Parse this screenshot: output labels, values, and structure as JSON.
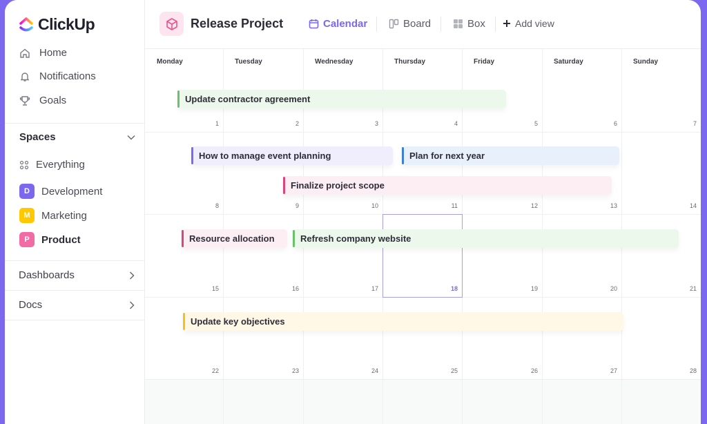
{
  "app": {
    "name": "ClickUp"
  },
  "sidebar": {
    "nav": [
      {
        "label": "Home",
        "icon": "home-icon"
      },
      {
        "label": "Notifications",
        "icon": "bell-icon"
      },
      {
        "label": "Goals",
        "icon": "trophy-icon"
      }
    ],
    "spaces_label": "Spaces",
    "everything_label": "Everything",
    "spaces": [
      {
        "initial": "D",
        "label": "Development",
        "color": "#7b68ee"
      },
      {
        "initial": "M",
        "label": "Marketing",
        "color": "#ffc800"
      },
      {
        "initial": "P",
        "label": "Product",
        "color": "#f36ba5"
      }
    ],
    "sections": [
      {
        "label": "Dashboards"
      },
      {
        "label": "Docs"
      }
    ]
  },
  "header": {
    "project_title": "Release Project",
    "views": [
      {
        "label": "Calendar",
        "icon": "calendar-icon",
        "active": true
      },
      {
        "label": "Board",
        "icon": "board-icon",
        "active": false
      },
      {
        "label": "Box",
        "icon": "box-grid-icon",
        "active": false
      }
    ],
    "add_view_label": "Add view"
  },
  "calendar": {
    "days": [
      "Monday",
      "Tuesday",
      "Wednesday",
      "Thursday",
      "Friday",
      "Saturday",
      "Sunday"
    ],
    "weeks": [
      [
        "1",
        "2",
        "3",
        "4",
        "5",
        "6",
        "7"
      ],
      [
        "8",
        "9",
        "10",
        "11",
        "12",
        "13",
        "14"
      ],
      [
        "15",
        "16",
        "17",
        "18",
        "19",
        "20",
        "21"
      ],
      [
        "22",
        "23",
        "24",
        "25",
        "26",
        "27",
        "28"
      ]
    ],
    "today": "18",
    "colors": {
      "accent": "#7b68ee"
    },
    "events": [
      {
        "title": "Update contractor agreement",
        "week": 0,
        "lane": 0,
        "bg": "#edf8ec",
        "bar": "#6cc06a"
      },
      {
        "title": "How to manage event planning",
        "week": 1,
        "lane": 0,
        "bg": "#f0eefc",
        "bar": "#7b68ee"
      },
      {
        "title": "Plan for next year",
        "week": 1,
        "lane": 0,
        "bg": "#e8f1fb",
        "bar": "#3d7fd0"
      },
      {
        "title": "Finalize project scope",
        "week": 1,
        "lane": 1,
        "bg": "#fdeef4",
        "bar": "#d9467c"
      },
      {
        "title": "Resource allocation",
        "week": 2,
        "lane": 0,
        "bg": "#fdeef4",
        "bar": "#d9467c"
      },
      {
        "title": "Refresh company website",
        "week": 2,
        "lane": 0,
        "bg": "#edf8ec",
        "bar": "#6cc06a"
      },
      {
        "title": "Update key objectives",
        "week": 3,
        "lane": 0,
        "bg": "#fff8e6",
        "bar": "#f2c218"
      }
    ]
  }
}
